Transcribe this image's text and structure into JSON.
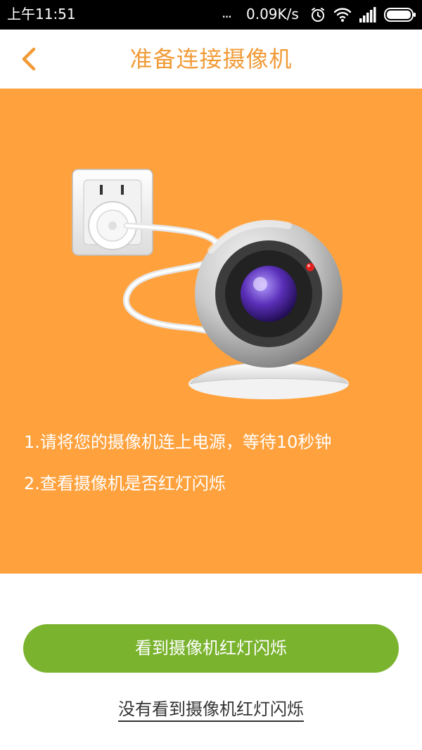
{
  "status_bar": {
    "time": "上午11:51",
    "dots": "...",
    "network_speed": "0.09K/s",
    "icons": [
      "alarm-icon",
      "wifi-icon",
      "signal-icon",
      "battery-icon"
    ]
  },
  "header": {
    "back_icon": "chevron-left-icon",
    "title": "准备连接摄像机"
  },
  "illustration": {
    "items": [
      "power-outlet-icon",
      "camera-icon"
    ]
  },
  "instructions": [
    "1.请将您的摄像机连上电源，等待10秒钟",
    "2.查看摄像机是否红灯闪烁"
  ],
  "actions": {
    "primary_label": "看到摄像机红灯闪烁",
    "secondary_label": "没有看到摄像机红灯闪烁"
  },
  "colors": {
    "accent": "#f19b37",
    "panel": "#ffa23e",
    "primary_button": "#7ab32e"
  }
}
